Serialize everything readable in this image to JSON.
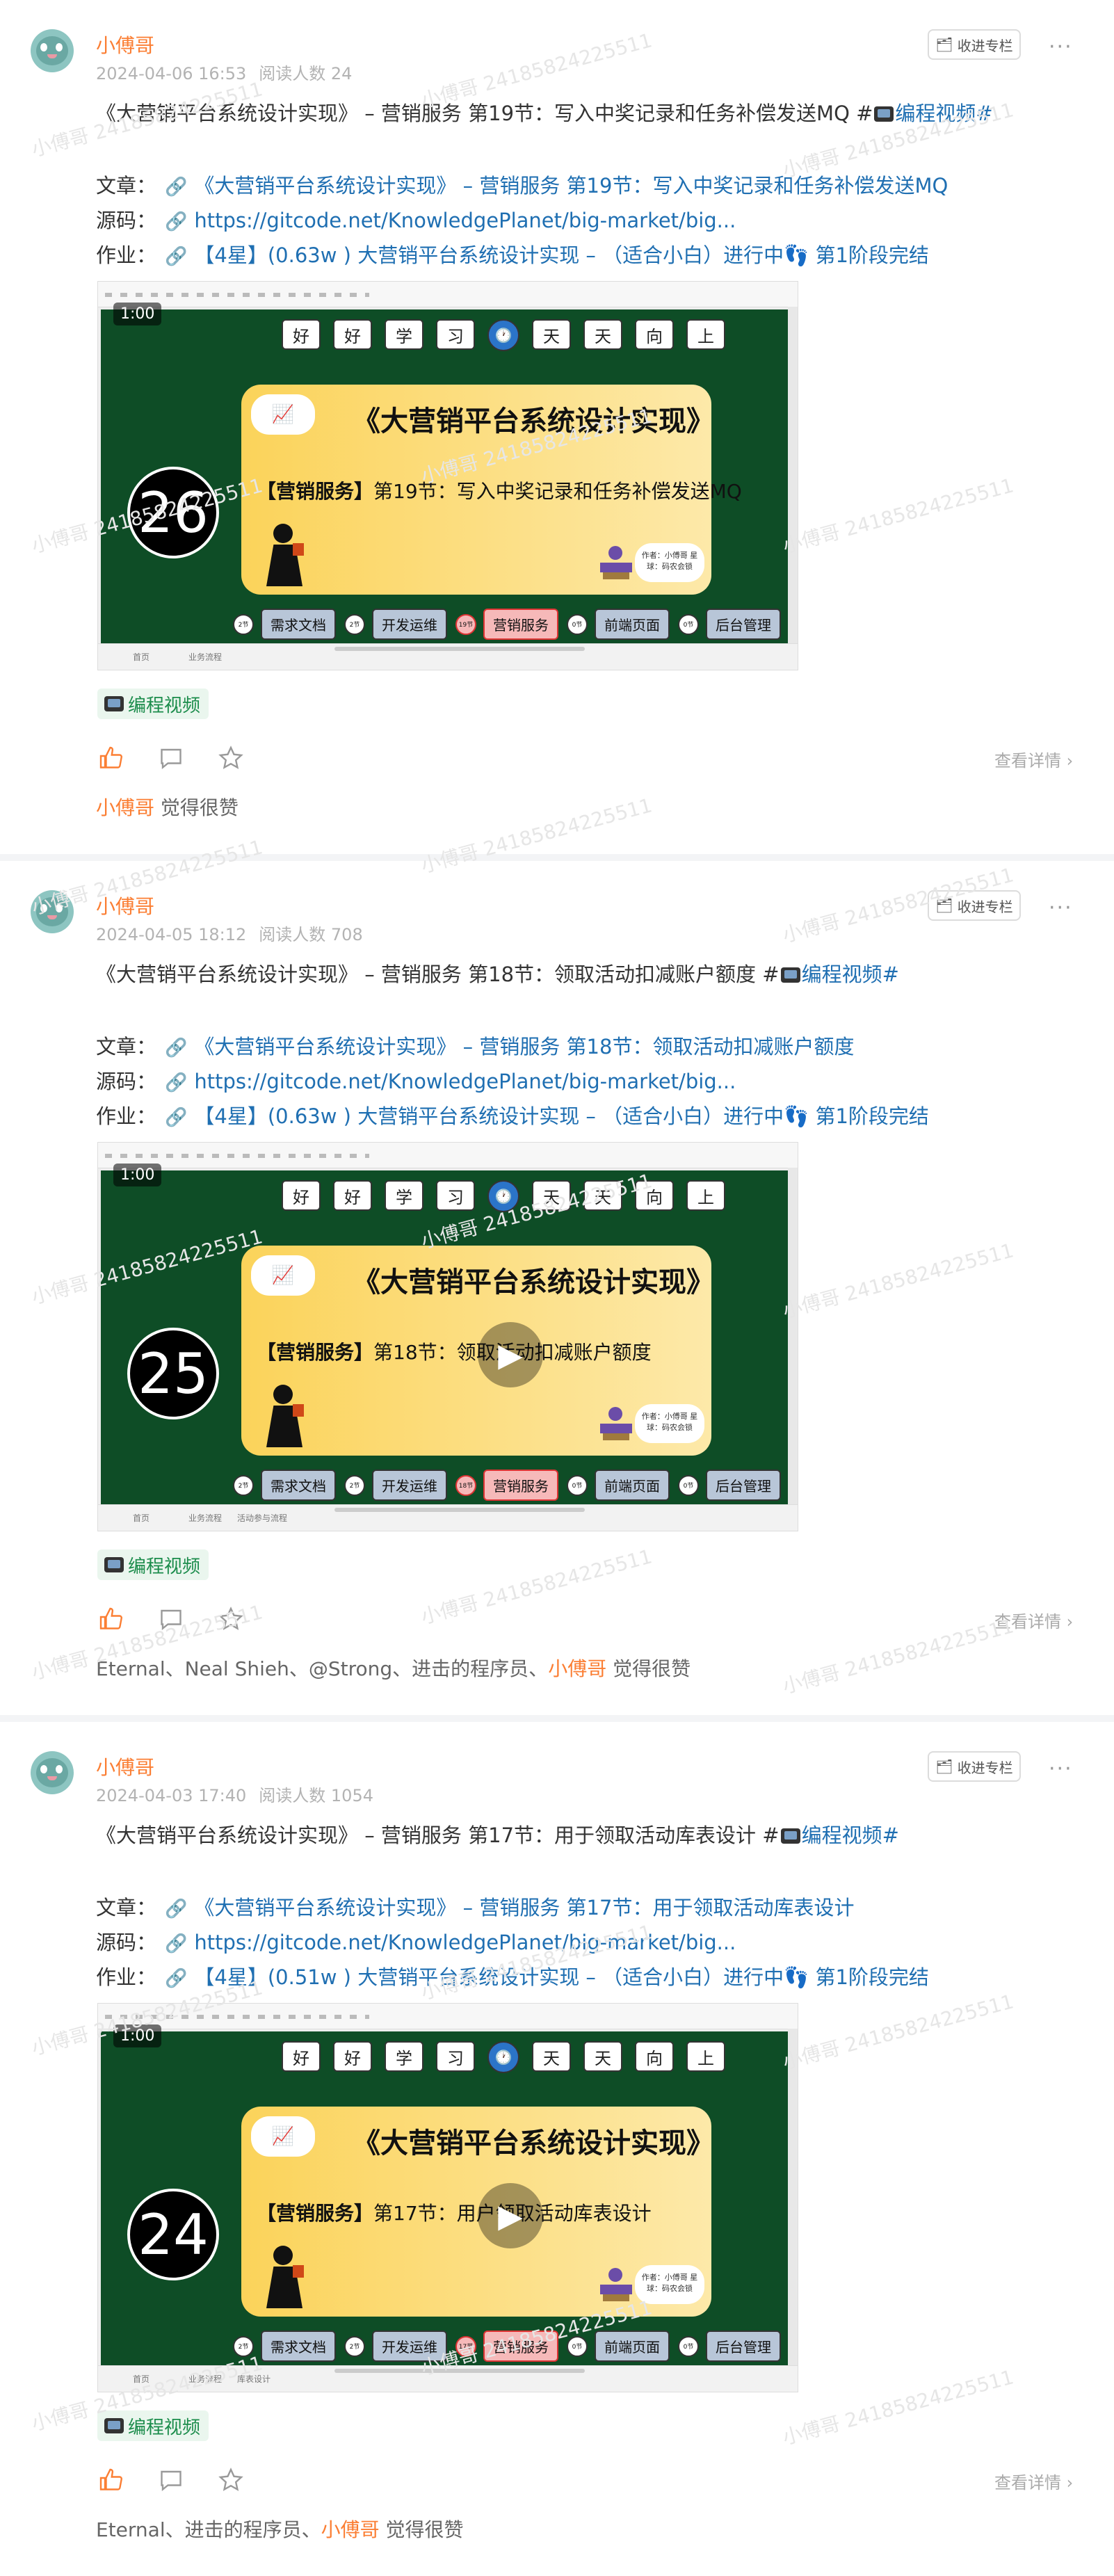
{
  "posts": [
    {
      "author": "小傅哥",
      "date": "2024-04-06 16:53",
      "reads": "阅读人数 24",
      "collect_label": "收进专栏",
      "more_label": "···",
      "title": "《大营销平台系统设计实现》 – 营销服务 第19节：写入中奖记录和任务补偿发送MQ #",
      "title_tag": "编程视频#",
      "article_key": "文章：",
      "article_val": "《大营销平台系统设计实现》 – 营销服务 第19节：写入中奖记录和任务补偿发送MQ",
      "source_key": "源码：",
      "source_val": "https://gitcode.net/KnowledgePlanet/big-market/big...",
      "homework_key": "作业：",
      "homework_val": "【4星】(0.63w ) 大营销平台系统设计实现 – （适合小白）进行中👣 第1阶段完结",
      "video": {
        "timestamp": "1:00",
        "chips": [
          "好",
          "好",
          "学",
          "习",
          "🕐",
          "天",
          "天",
          "向",
          "上"
        ],
        "number": "26",
        "head": "《大营销平台系统设计实现》",
        "sub_bold": "【营销服务】",
        "sub_rest": "第19节：写入中奖记录和任务补偿发送MQ",
        "author_box": "作者：小傅哥 星球：码农会锁",
        "tabs": [
          "需求文档",
          "开发运维",
          "营销服务",
          "前端页面",
          "后台管理"
        ],
        "tab_icons": [
          "2节",
          "2节",
          "19节",
          "0节",
          "0节"
        ],
        "bottom_tabs": [
          "首页",
          "业务流程"
        ],
        "play": ""
      },
      "topic": "编程视频",
      "detail": "查看详情 ›",
      "likes_names": "",
      "likes_me": "小傅哥",
      "likes_suffix": " 觉得很赞"
    },
    {
      "author": "小傅哥",
      "date": "2024-04-05 18:12",
      "reads": "阅读人数 708",
      "collect_label": "收进专栏",
      "more_label": "···",
      "title": "《大营销平台系统设计实现》 – 营销服务 第18节：领取活动扣减账户额度 #",
      "title_tag": "编程视频#",
      "article_key": "文章：",
      "article_val": "《大营销平台系统设计实现》 – 营销服务 第18节：领取活动扣减账户额度",
      "source_key": "源码：",
      "source_val": "https://gitcode.net/KnowledgePlanet/big-market/big...",
      "homework_key": "作业：",
      "homework_val": "【4星】(0.63w ) 大营销平台系统设计实现 – （适合小白）进行中👣 第1阶段完结",
      "video": {
        "timestamp": "1:00",
        "chips": [
          "好",
          "好",
          "学",
          "习",
          "🕐",
          "天",
          "天",
          "向",
          "上"
        ],
        "number": "25",
        "head": "《大营销平台系统设计实现》",
        "sub_bold": "【营销服务】",
        "sub_rest": "第18节：领取活动扣减账户额度",
        "author_box": "作者：小傅哥 星球：码农会锁",
        "tabs": [
          "需求文档",
          "开发运维",
          "营销服务",
          "前端页面",
          "后台管理"
        ],
        "tab_icons": [
          "2节",
          "2节",
          "18节",
          "0节",
          "0节"
        ],
        "bottom_tabs": [
          "首页",
          "业务流程",
          "活动参与流程"
        ],
        "play": "▶"
      },
      "topic": "编程视频",
      "detail": "查看详情 ›",
      "likes_names": "Eternal、Neal Shieh、@Strong、进击的程序员、",
      "likes_me": "小傅哥",
      "likes_suffix": " 觉得很赞"
    },
    {
      "author": "小傅哥",
      "date": "2024-04-03 17:40",
      "reads": "阅读人数 1054",
      "collect_label": "收进专栏",
      "more_label": "···",
      "title": "《大营销平台系统设计实现》 – 营销服务 第17节：用于领取活动库表设计 #",
      "title_tag": "编程视频#",
      "article_key": "文章：",
      "article_val": "《大营销平台系统设计实现》 – 营销服务 第17节：用于领取活动库表设计",
      "source_key": "源码：",
      "source_val": "https://gitcode.net/KnowledgePlanet/big-market/big...",
      "homework_key": "作业：",
      "homework_val": "【4星】(0.51w ) 大营销平台系统设计实现 – （适合小白）进行中👣 第1阶段完结",
      "video": {
        "timestamp": "1:00",
        "chips": [
          "好",
          "好",
          "学",
          "习",
          "🕐",
          "天",
          "天",
          "向",
          "上"
        ],
        "number": "24",
        "head": "《大营销平台系统设计实现》",
        "sub_bold": "【营销服务】",
        "sub_rest": "第17节：用户领取活动库表设计",
        "author_box": "作者：小傅哥 星球：码农会锁",
        "tabs": [
          "需求文档",
          "开发运维",
          "营销服务",
          "前端页面",
          "后台管理"
        ],
        "tab_icons": [
          "2节",
          "2节",
          "17节",
          "0节",
          "0节"
        ],
        "bottom_tabs": [
          "首页",
          "业务流程",
          "库表设计"
        ],
        "play": "▶"
      },
      "topic": "编程视频",
      "detail": "查看详情 ›",
      "likes_names": "Eternal、进击的程序员、",
      "likes_me": "小傅哥",
      "likes_suffix": " 觉得很赞"
    }
  ],
  "watermark": "小傅哥 24185824225511",
  "colors": {
    "accent": "#fb7e33",
    "link": "#1f6fb2",
    "stage": "#0e4d26",
    "topic_bg": "#eaf6ee",
    "topic_fg": "#1b8c4b"
  }
}
